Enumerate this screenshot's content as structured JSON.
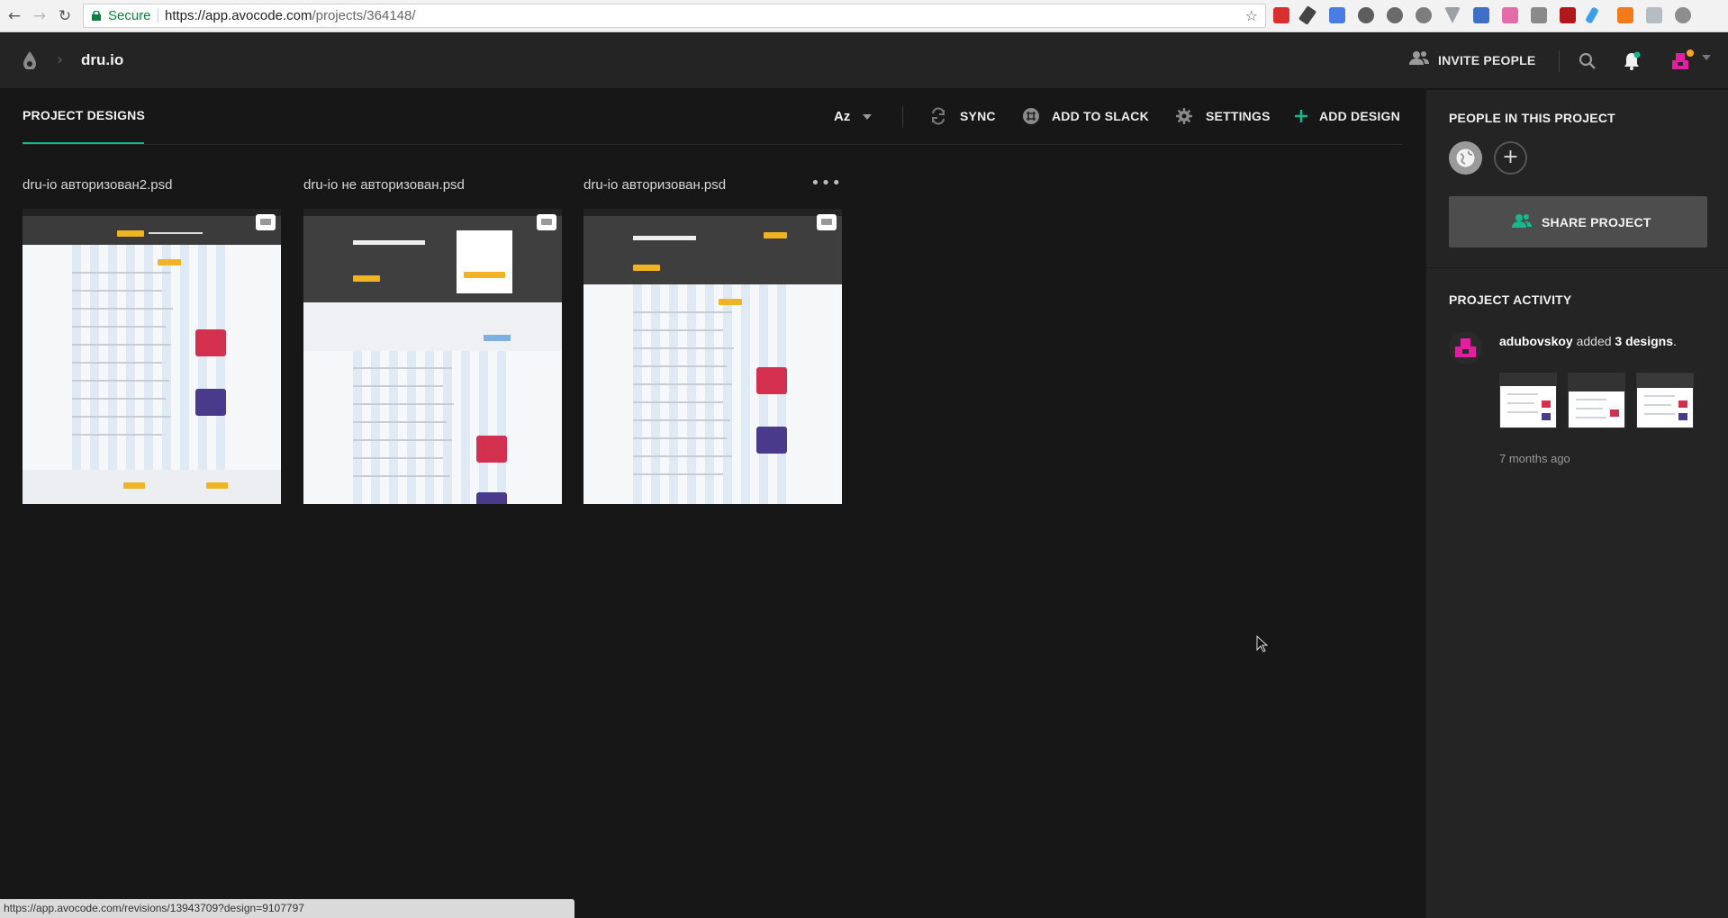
{
  "browser": {
    "secure_label": "Secure",
    "url_host": "https://app.avocode.com",
    "url_path": "/projects/364148/",
    "back_icon": "arrow-left-icon",
    "forward_icon": "arrow-right-icon",
    "reload_icon": "reload-icon",
    "star_icon": "star-icon"
  },
  "header": {
    "project_name": "dru.io",
    "invite_label": "INVITE PEOPLE",
    "accent_color": "#17b890",
    "notification_dot_color": "#f5a623"
  },
  "main": {
    "tab_label": "PROJECT DESIGNS",
    "sort_label": "Az",
    "toolbar": {
      "sync_label": "SYNC",
      "slack_label": "ADD TO SLACK",
      "settings_label": "SETTINGS",
      "add_design_label": "ADD DESIGN"
    },
    "designs": [
      {
        "title": "dru-io авторизован2.psd"
      },
      {
        "title": "dru-io не авторизован.psd"
      },
      {
        "title": "dru-io авторизован.psd"
      }
    ],
    "more_label": "•••"
  },
  "side": {
    "people_heading": "PEOPLE IN THIS PROJECT",
    "share_label": "SHARE PROJECT",
    "activity_heading": "PROJECT ACTIVITY",
    "activity": {
      "user": "adubovskoy",
      "verb": " added ",
      "count": "3 designs",
      "period": ".",
      "time": "7 months ago"
    }
  },
  "status_bar": {
    "text": "https://app.avocode.com/revisions/13943709?design=9107797"
  }
}
